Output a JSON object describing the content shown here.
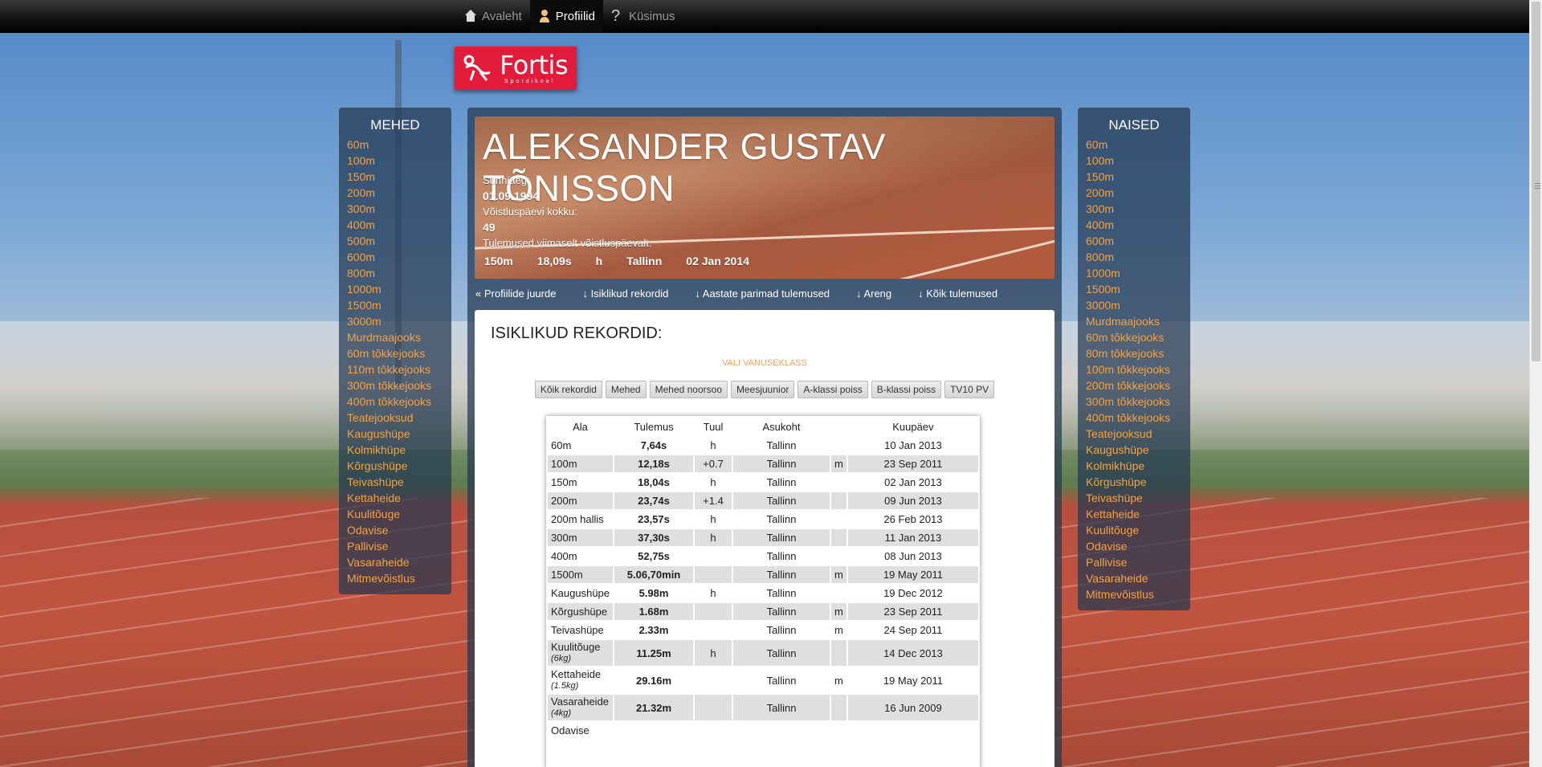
{
  "nav": {
    "items": [
      {
        "label": "Avaleht",
        "icon": "home-icon",
        "active": false
      },
      {
        "label": "Profiilid",
        "icon": "user-icon",
        "active": true
      },
      {
        "label": "Küsimus",
        "icon": "question-icon",
        "active": false
      }
    ]
  },
  "logo": {
    "text": "Fortis",
    "sub": "Spordikool"
  },
  "left_panel": {
    "title": "MEHED",
    "items": [
      "60m",
      "100m",
      "150m",
      "200m",
      "300m",
      "400m",
      "500m",
      "600m",
      "800m",
      "1000m",
      "1500m",
      "3000m",
      "Murdmaajooks",
      "60m tõkkejooks",
      "110m tõkkejooks",
      "300m tõkkejooks",
      "400m tõkkejooks",
      "Teatejooksud",
      "Kaugushüpe",
      "Kolmikhüpe",
      "Kõrgushüpe",
      "Teivashüpe",
      "Kettaheide",
      "Kuulitõuge",
      "Odavise",
      "Pallivise",
      "Vasaraheide",
      "Mitmevõistlus"
    ]
  },
  "right_panel": {
    "title": "NAISED",
    "items": [
      "60m",
      "100m",
      "150m",
      "200m",
      "300m",
      "400m",
      "600m",
      "800m",
      "1000m",
      "1500m",
      "3000m",
      "Murdmaajooks",
      "60m tõkkejooks",
      "80m tõkkejooks",
      "100m tõkkejooks",
      "200m tõkkejooks",
      "300m tõkkejooks",
      "400m tõkkejooks",
      "Teatejooksud",
      "Kaugushüpe",
      "Kolmikhüpe",
      "Kõrgushüpe",
      "Teivashüpe",
      "Kettaheide",
      "Kuulitõuge",
      "Odavise",
      "Pallivise",
      "Vasaraheide",
      "Mitmevõistlus"
    ]
  },
  "profile": {
    "name": "ALEKSANDER GUSTAV TÕNISSON",
    "birth_label": "Sünniaeg:",
    "birth_value": "01.09.1994",
    "days_label": "Võistluspäevi kokku:",
    "days_value": "49",
    "last_label": "Tulemused viimaselt võistluspäevalt:",
    "last": {
      "event": "150m",
      "result": "18,09s",
      "wind": "h",
      "place": "Tallinn",
      "date": "02 Jan 2014"
    }
  },
  "subnav": [
    "« Profiilide juurde",
    "↓ Isiklikud rekordid",
    "↓ Aastate parimad tulemused",
    "↓ Areng",
    "↓ Kõik tulemused"
  ],
  "records": {
    "title": "ISIKLIKUD REKORDID:",
    "select_label": "VALI VANUSEKLASS",
    "filters": [
      "Kõik rekordid",
      "Mehed",
      "Mehed noorsoo",
      "Meesjuunior",
      "A-klassi poiss",
      "B-klassi poiss",
      "TV10 PV"
    ],
    "headers": [
      "Ala",
      "Tulemus",
      "Tuul",
      "Asukoht",
      "",
      "Kuupäev"
    ],
    "rows": [
      {
        "event": "60m",
        "note": "",
        "result": "7,64s",
        "wind": "h",
        "place": "Tallinn",
        "flag": "",
        "date": "10 Jan 2013"
      },
      {
        "event": "100m",
        "note": "",
        "result": "12,18s",
        "wind": "+0.7",
        "place": "Tallinn",
        "flag": "m",
        "date": "23 Sep 2011"
      },
      {
        "event": "150m",
        "note": "",
        "result": "18,04s",
        "wind": "h",
        "place": "Tallinn",
        "flag": "",
        "date": "02 Jan 2013"
      },
      {
        "event": "200m",
        "note": "",
        "result": "23,74s",
        "wind": "+1.4",
        "place": "Tallinn",
        "flag": "",
        "date": "09 Jun 2013"
      },
      {
        "event": "200m hallis",
        "note": "",
        "result": "23,57s",
        "wind": "h",
        "place": "Tallinn",
        "flag": "",
        "date": "26 Feb 2013"
      },
      {
        "event": "300m",
        "note": "",
        "result": "37,30s",
        "wind": "h",
        "place": "Tallinn",
        "flag": "",
        "date": "11 Jan 2013"
      },
      {
        "event": "400m",
        "note": "",
        "result": "52,75s",
        "wind": "",
        "place": "Tallinn",
        "flag": "",
        "date": "08 Jun 2013"
      },
      {
        "event": "1500m",
        "note": "",
        "result": "5.06,70min",
        "wind": "",
        "place": "Tallinn",
        "flag": "m",
        "date": "19 May 2011"
      },
      {
        "event": "Kaugushüpe",
        "note": "",
        "result": "5.98m",
        "wind": "h",
        "place": "Tallinn",
        "flag": "",
        "date": "19 Dec 2012"
      },
      {
        "event": "Kõrgushüpe",
        "note": "",
        "result": "1.68m",
        "wind": "",
        "place": "Tallinn",
        "flag": "m",
        "date": "23 Sep 2011"
      },
      {
        "event": "Teivashüpe",
        "note": "",
        "result": "2.33m",
        "wind": "",
        "place": "Tallinn",
        "flag": "m",
        "date": "24 Sep 2011"
      },
      {
        "event": "Kuulitõuge",
        "note": "(6kg)",
        "result": "11.25m",
        "wind": "h",
        "place": "Tallinn",
        "flag": "",
        "date": "14 Dec 2013"
      },
      {
        "event": "Kettaheide",
        "note": "(1.5kg)",
        "result": "29.16m",
        "wind": "",
        "place": "Tallinn",
        "flag": "m",
        "date": "19 May 2011"
      },
      {
        "event": "Vasaraheide",
        "note": "(4kg)",
        "result": "21.32m",
        "wind": "",
        "place": "Tallinn",
        "flag": "",
        "date": "16 Jun 2009"
      },
      {
        "event": "Odavise",
        "note": "",
        "result": "",
        "wind": "",
        "place": "",
        "flag": "",
        "date": ""
      }
    ]
  }
}
